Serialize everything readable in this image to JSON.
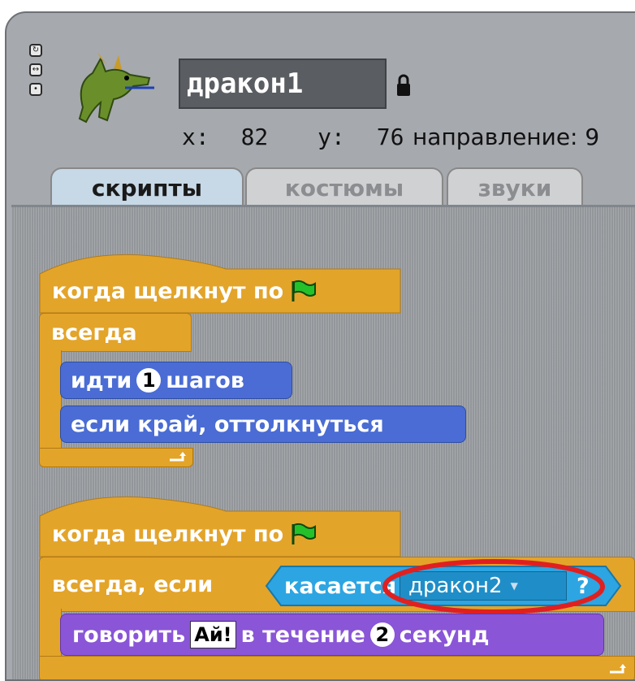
{
  "sprite": {
    "name": "дракон1",
    "x_label": "x:",
    "x_value": "82",
    "y_label": "y:",
    "y_value": "76",
    "direction_label": "направление:",
    "direction_value": "9"
  },
  "rotation_buttons": [
    "rotate-icon",
    "left-right-icon",
    "no-rotate-icon"
  ],
  "tabs": [
    {
      "label": "скрипты",
      "active": true
    },
    {
      "label": "костюмы",
      "active": false
    },
    {
      "label": "звуки",
      "active": false
    }
  ],
  "script1": {
    "hat": "когда щелкнут по",
    "forever": "всегда",
    "move_prefix": "идти",
    "move_steps": "1",
    "move_suffix": "шагов",
    "bounce": "если край, оттолкнуться"
  },
  "script2": {
    "hat": "когда щелкнут по",
    "forever_if": "всегда, если",
    "touching": "касается",
    "touching_target": "дракон2",
    "question_mark": "?",
    "say_prefix": "говорить",
    "say_text": "Ай!",
    "say_middle": "в течение",
    "say_secs": "2",
    "say_suffix": "секунд"
  },
  "colors": {
    "control": "#e3a42a",
    "motion": "#4a6cd4",
    "looks": "#8a55d7",
    "sensing": "#2ca5e2",
    "highlight": "#e02020"
  }
}
